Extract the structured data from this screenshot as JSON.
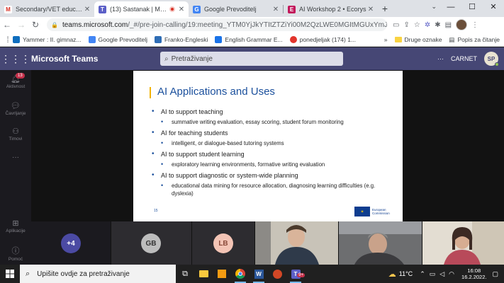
{
  "browser": {
    "tabs": [
      {
        "title": "Secondary/VET education",
        "active": false
      },
      {
        "title": "(13) Sastanak | Microsoft Teams",
        "active": true
      },
      {
        "title": "Google Prevoditelj",
        "active": false
      },
      {
        "title": "AI Workshop 2 • Ecorys",
        "active": false
      }
    ],
    "new_tab": "+",
    "url_domain": "teams.microsoft.com",
    "url_path": "/_#/pre-join-calling/19:meeting_YTM0YjJkYTItZTZiYi00M2QzLWE0MGItMGUxYmJkZjhmNGFk...",
    "bookmarks": [
      {
        "label": "Yammer : II. gimnaz...",
        "color": "#106ebe"
      },
      {
        "label": "Google Prevoditelj",
        "color": "#4285f4"
      },
      {
        "label": "Franko-Engleski",
        "color": "#2f6db5"
      },
      {
        "label": "English Grammar E...",
        "color": "#1a73e8"
      },
      {
        "label": "ponedjeljak (174) 1...",
        "color": "#e2352c"
      }
    ],
    "bookmarks_more": "»",
    "bookmark_folder": "Druge oznake",
    "reading_list": "Popis za čitanje"
  },
  "teams": {
    "app_title": "Microsoft Teams",
    "search_placeholder": "Pretraživanje",
    "more": "···",
    "org_name": "CARNET",
    "user_initials": "SP",
    "rail": [
      {
        "label": "Aktivnost",
        "icon": "bell-icon",
        "badge": "13"
      },
      {
        "label": "Čavrljanje",
        "icon": "chat-icon"
      },
      {
        "label": "Timovi",
        "icon": "teams-icon"
      },
      {
        "label": "···",
        "icon": "more-icon"
      },
      {
        "label": "Aplikacije",
        "icon": "apps-icon"
      },
      {
        "label": "Pomoć",
        "icon": "help-icon"
      }
    ]
  },
  "slide": {
    "title": "AI Applications and Uses",
    "bullets": [
      {
        "text": "AI to support teaching",
        "sub": [
          "summative writing evaluation, essay scoring, student forum monitoring"
        ]
      },
      {
        "text": "AI for teaching students",
        "sub": [
          "intelligent, or dialogue-based tutoring systems"
        ]
      },
      {
        "text": "AI to support student learning",
        "sub": [
          "exploratory learning environments, formative writing evaluation"
        ]
      },
      {
        "text": "AI to support diagnostic or system-wide planning",
        "sub": [
          "educational data mining for resource allocation, diagnosing learning difficulties (e.g. dyslexia)"
        ]
      }
    ],
    "page_number": "15",
    "logo_text_1": "European",
    "logo_text_2": "Commission"
  },
  "participants": [
    {
      "label": "+4",
      "color": "#4b4aa3"
    },
    {
      "label": "GB",
      "color": "#bdbdbd"
    },
    {
      "label": "LB",
      "color": "#f3c4b5"
    }
  ],
  "taskbar": {
    "search_placeholder": "Upišite ovdje za pretraživanje",
    "weather": "11°C",
    "time": "16:08",
    "date": "16.2.2022.",
    "teams_badge": "9+"
  }
}
